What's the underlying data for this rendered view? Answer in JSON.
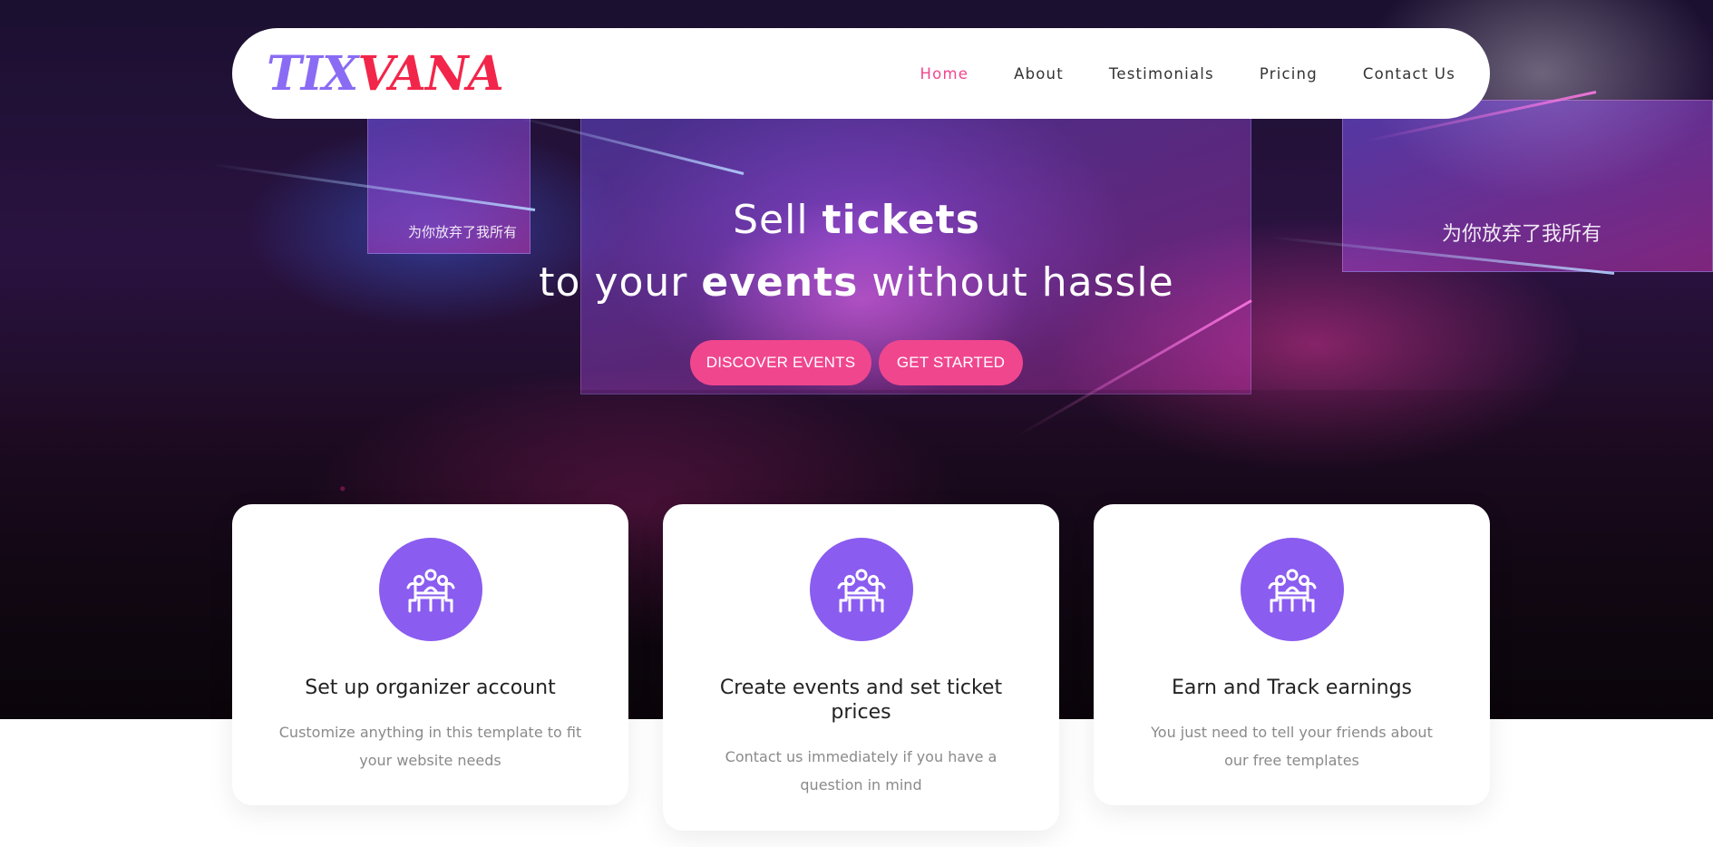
{
  "brand": {
    "logo_part1": "TIX",
    "logo_part2": "VANA",
    "colors": {
      "logo_part1": "#8a6cf4",
      "logo_part2": "#f2264a",
      "accent": "#f0468e",
      "icon_bg": "#8a5cf0"
    }
  },
  "nav": {
    "items": [
      {
        "label": "Home",
        "active": true
      },
      {
        "label": "About",
        "active": false
      },
      {
        "label": "Testimonials",
        "active": false
      },
      {
        "label": "Pricing",
        "active": false
      },
      {
        "label": "Contact Us",
        "active": false
      }
    ]
  },
  "hero": {
    "line1_a": "Sell ",
    "line1_b": "tickets",
    "line2_a": "to your ",
    "line2_b": "events",
    "line2_c": " without hassle",
    "screen_text_left": "为你放弃了我所有",
    "screen_text_right": "为你放弃了我所有",
    "buttons": {
      "discover": "DISCOVER EVENTS",
      "start": "GET STARTED"
    }
  },
  "features": [
    {
      "icon": "meeting-table-icon",
      "title": "Set up organizer account",
      "text": "Customize anything in this template to fit your website needs"
    },
    {
      "icon": "meeting-table-icon",
      "title": "Create events and set ticket prices",
      "text": "Contact us immediately if you have a question in mind"
    },
    {
      "icon": "meeting-table-icon",
      "title": "Earn and Track earnings",
      "text": "You just need to tell your friends about our free templates"
    }
  ]
}
